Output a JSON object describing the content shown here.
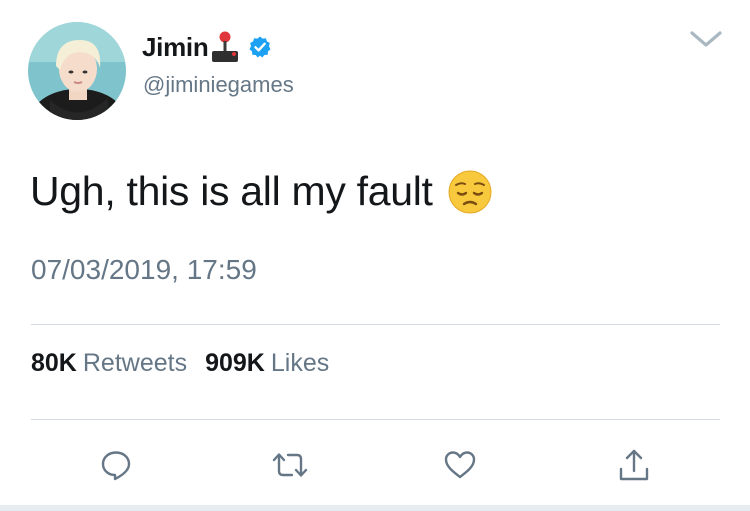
{
  "tweet": {
    "author": {
      "display_name": "Jimin",
      "handle": "@jiminiegames",
      "badge_emoji_icon": "joystick-icon",
      "verified": true,
      "verified_color": "#1da1f2"
    },
    "text": "Ugh, this is all my fault",
    "text_emoji_icon": "pensive-face-icon",
    "timestamp": "07/03/2019, 17:59",
    "stats": {
      "retweets_count": "80K",
      "retweets_label": "Retweets",
      "likes_count": "909K",
      "likes_label": "Likes"
    },
    "actions": [
      "reply-icon",
      "retweet-icon",
      "like-icon",
      "share-icon"
    ]
  },
  "colors": {
    "text_primary": "#14171a",
    "text_secondary": "#657786",
    "divider": "#d5dbe0"
  }
}
